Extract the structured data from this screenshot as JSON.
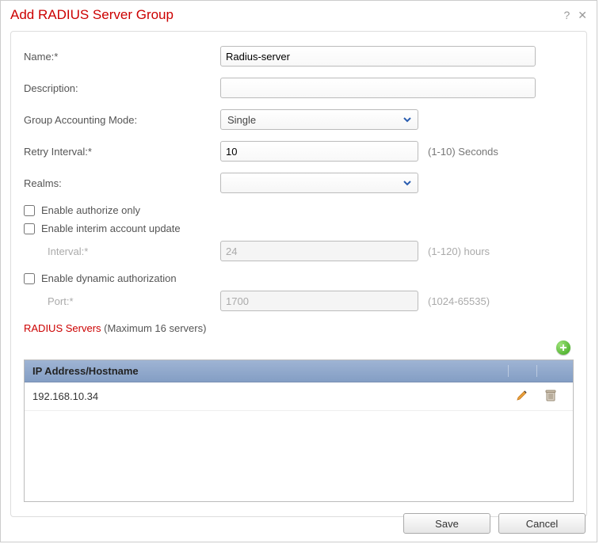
{
  "dialog": {
    "title": "Add RADIUS Server Group"
  },
  "form": {
    "name_label": "Name:*",
    "name_value": "Radius-server",
    "description_label": "Description:",
    "description_value": "",
    "group_accounting_label": "Group Accounting Mode:",
    "group_accounting_value": "Single",
    "retry_label": "Retry Interval:*",
    "retry_value": "10",
    "retry_hint": "(1-10) Seconds",
    "realms_label": "Realms:",
    "realms_value": "",
    "authorize_only_label": "Enable authorize only",
    "interim_label": "Enable interim account update",
    "interval_label": "Interval:*",
    "interval_value": "24",
    "interval_hint": "(1-120) hours",
    "dynamic_auth_label": "Enable dynamic authorization",
    "port_label": "Port:*",
    "port_value": "1700",
    "port_hint": "(1024-65535)"
  },
  "servers": {
    "title": "RADIUS Servers",
    "subtitle": " (Maximum 16 servers)",
    "column_header": "IP Address/Hostname",
    "rows": [
      {
        "ip": "192.168.10.34"
      }
    ]
  },
  "footer": {
    "save": "Save",
    "cancel": "Cancel"
  }
}
